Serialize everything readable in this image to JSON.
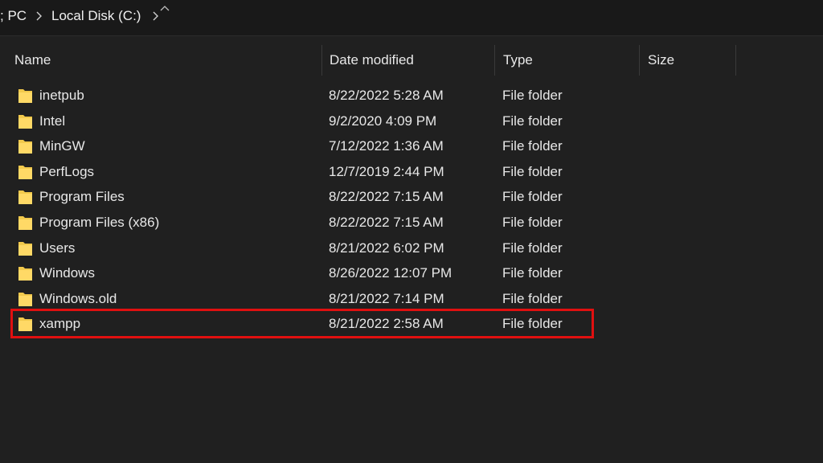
{
  "breadcrumb": {
    "items": [
      "; PC",
      "Local Disk (C:)"
    ],
    "separator": ">"
  },
  "columns": {
    "name": "Name",
    "date_modified": "Date modified",
    "type": "Type",
    "size": "Size"
  },
  "rows": [
    {
      "name": "inetpub",
      "date": "8/22/2022 5:28 AM",
      "type": "File folder",
      "size": ""
    },
    {
      "name": "Intel",
      "date": "9/2/2020 4:09 PM",
      "type": "File folder",
      "size": ""
    },
    {
      "name": "MinGW",
      "date": "7/12/2022 1:36 AM",
      "type": "File folder",
      "size": ""
    },
    {
      "name": "PerfLogs",
      "date": "12/7/2019 2:44 PM",
      "type": "File folder",
      "size": ""
    },
    {
      "name": "Program Files",
      "date": "8/22/2022 7:15 AM",
      "type": "File folder",
      "size": ""
    },
    {
      "name": "Program Files (x86)",
      "date": "8/22/2022 7:15 AM",
      "type": "File folder",
      "size": ""
    },
    {
      "name": "Users",
      "date": "8/21/2022 6:02 PM",
      "type": "File folder",
      "size": ""
    },
    {
      "name": "Windows",
      "date": "8/26/2022 12:07 PM",
      "type": "File folder",
      "size": ""
    },
    {
      "name": "Windows.old",
      "date": "8/21/2022 7:14 PM",
      "type": "File folder",
      "size": ""
    },
    {
      "name": "xampp",
      "date": "8/21/2022 2:58 AM",
      "type": "File folder",
      "size": "",
      "highlighted": true
    }
  ],
  "icons": {
    "folder": "folder-icon",
    "breadcrumb_separator": "chevron-right-icon",
    "sort": "chevron-up-icon"
  },
  "colors": {
    "background": "#202020",
    "folder": "#f2c94c",
    "highlight": "#e01010"
  }
}
